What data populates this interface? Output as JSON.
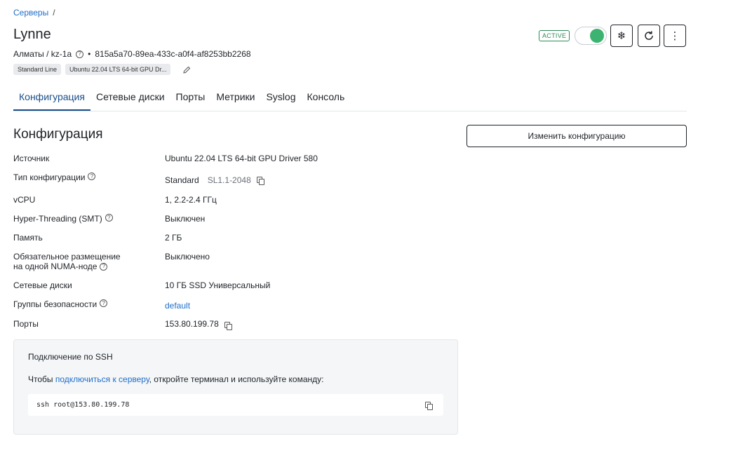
{
  "breadcrumb": {
    "root": "Серверы",
    "sep": "/"
  },
  "server": {
    "name": "Lynne",
    "region": "Алматы / kz-1a",
    "dot": "•",
    "uuid": "815a5a70-89ea-433c-a0f4-af8253bb2268",
    "tags": [
      "Standard Line",
      "Ubuntu 22.04 LTS 64-bit GPU Dr..."
    ],
    "status": "ACTIVE"
  },
  "tabs": [
    "Конфигурация",
    "Сетевые диски",
    "Порты",
    "Метрики",
    "Syslog",
    "Консоль"
  ],
  "section": {
    "title": "Конфигурация",
    "change_button": "Изменить конфигурацию"
  },
  "config": {
    "source": {
      "label": "Источник",
      "value": "Ubuntu 22.04 LTS 64-bit GPU Driver 580"
    },
    "type": {
      "label": "Тип конфигурации",
      "value": "Standard",
      "code": "SL1.1-2048"
    },
    "vcpu": {
      "label": "vCPU",
      "value": "1, 2.2-2.4 ГГц"
    },
    "smt": {
      "label": "Hyper-Threading (SMT)",
      "value": "Выключен"
    },
    "memory": {
      "label": "Память",
      "value": "2 ГБ"
    },
    "numa": {
      "label_line1": "Обязательное размещение",
      "label_line2": "на одной NUMA-ноде",
      "value": "Выключено"
    },
    "disks": {
      "label": "Сетевые диски",
      "value": "10 ГБ SSD Универсальный"
    },
    "security_groups": {
      "label": "Группы безопасности",
      "value": "default"
    },
    "ports": {
      "label": "Порты",
      "value": "153.80.199.78"
    }
  },
  "ssh": {
    "title": "Подключение по SSH",
    "text_before": "Чтобы ",
    "link": "подключиться к серверу",
    "text_after": ", откройте терминал и используйте команду:",
    "command": "ssh root@153.80.199.78"
  },
  "icons": {
    "help": "question-circle-icon",
    "edit": "pencil-icon",
    "freeze": "snowflake-icon",
    "refresh": "refresh-icon",
    "more": "kebab-menu-icon",
    "copy": "copy-icon"
  },
  "colors": {
    "link": "#1f6fc9",
    "active_tab": "#1a4f8b",
    "status": "#2e8b57",
    "toggle_on": "#3cb371"
  }
}
